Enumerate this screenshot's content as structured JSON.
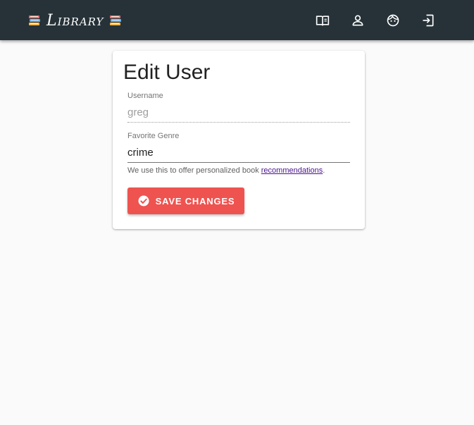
{
  "app": {
    "brand": "Library",
    "brand_icon": "books-icon",
    "header_bg": "#263238"
  },
  "nav": {
    "icons": [
      "book-open-icon",
      "user-icon",
      "face-icon",
      "sign-in-icon"
    ]
  },
  "form": {
    "title": "Edit User",
    "username": {
      "label": "Username",
      "value": "greg",
      "disabled": true
    },
    "genre": {
      "label": "Favorite Genre",
      "value": "crime"
    },
    "hint_text": "We use this to offer personalized book ",
    "hint_link": "recommendations",
    "hint_end": ".",
    "save_label": "SAVE CHANGES",
    "save_icon": "check-circle-icon",
    "accent": "#ef5350"
  }
}
